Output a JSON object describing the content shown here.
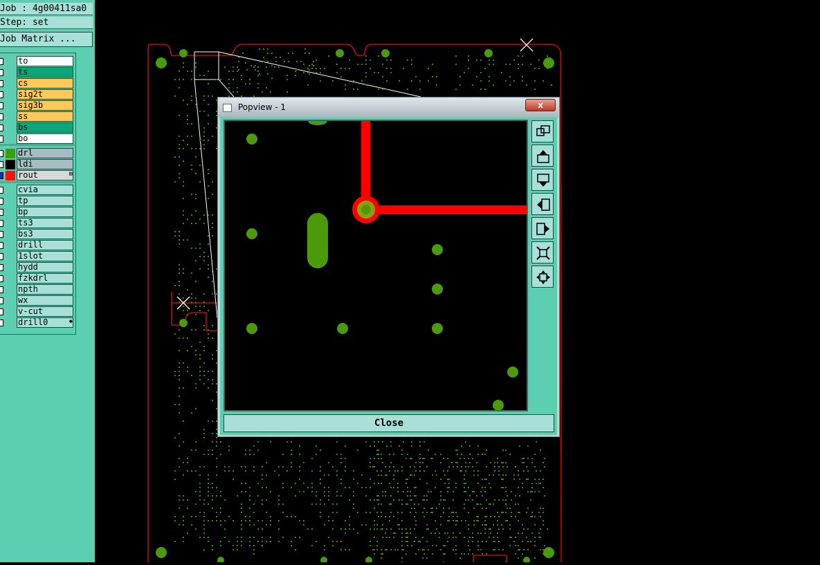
{
  "info": {
    "job_line": "Job : 4g00411sa0",
    "step_line": "Step: set",
    "matrix_button": "Job Matrix ..."
  },
  "layers_group1": [
    {
      "name": "to",
      "color": "#ffffff"
    },
    {
      "name": "ts",
      "color": "#0ea57a"
    },
    {
      "name": "cs",
      "color": "#ffc85a"
    },
    {
      "name": "sig2t",
      "color": "#ffc85a"
    },
    {
      "name": "sig3b",
      "color": "#ffc85a"
    },
    {
      "name": "ss",
      "color": "#ffc85a"
    },
    {
      "name": "bs",
      "color": "#0ea57a"
    },
    {
      "name": "bo",
      "color": "#ffffff"
    }
  ],
  "layers_group2": [
    {
      "name": "drl",
      "color": "#a8bcc4",
      "swatch": "#3aa00a"
    },
    {
      "name": "ldi",
      "color": "#a8bcc4",
      "swatch": "#000000"
    },
    {
      "name": "rout",
      "color": "#d8d8d8",
      "swatch": "#ff1010"
    }
  ],
  "layers_group3": [
    {
      "name": "cvia"
    },
    {
      "name": "tp"
    },
    {
      "name": "bp"
    },
    {
      "name": "ts3"
    },
    {
      "name": "bs3"
    },
    {
      "name": "drill"
    },
    {
      "name": "1slot"
    },
    {
      "name": "hydd"
    },
    {
      "name": "fzkdrl"
    },
    {
      "name": "npth"
    },
    {
      "name": "wx"
    },
    {
      "name": "v-cut"
    },
    {
      "name": "drill0"
    }
  ],
  "popview": {
    "title": "Popview - 1",
    "close_x": "x",
    "close_button": "Close",
    "tools": [
      "zoom-fit-icon",
      "pan-up-icon",
      "pan-down-icon",
      "pan-left-icon",
      "pan-right-icon",
      "zoom-in-icon",
      "zoom-out-icon"
    ]
  },
  "colors": {
    "panel_bg": "#5ccfb0",
    "field_bg": "#a8e0d8",
    "pad_green": "#4a9a0a",
    "route_red": "#ff0000"
  }
}
